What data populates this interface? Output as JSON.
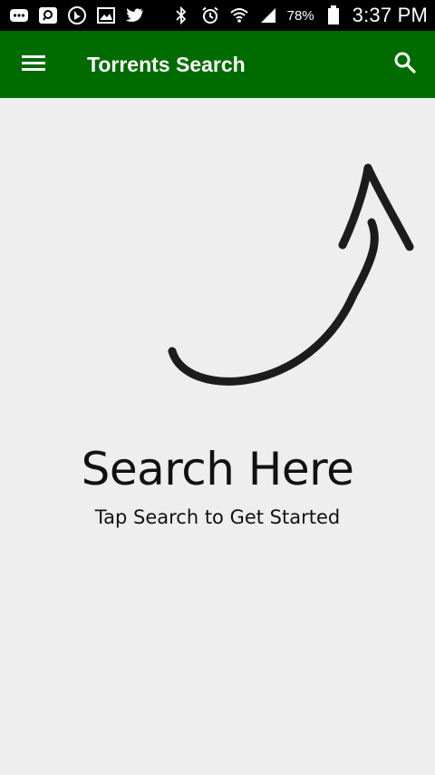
{
  "status_bar": {
    "battery_percent": "78%",
    "time": "3:37 PM",
    "left_icons": [
      "message-icon",
      "app-icon",
      "bing-icon",
      "gallery-icon",
      "twitter-icon"
    ],
    "right_icons": [
      "bluetooth-icon",
      "alarm-icon",
      "wifi-icon",
      "signal-icon",
      "battery-icon"
    ]
  },
  "app_bar": {
    "title": "Torrents Search",
    "background": "#006b00",
    "menu_icon": "hamburger-menu-icon",
    "search_icon": "search-icon"
  },
  "empty_state": {
    "title": "Search Here",
    "subtitle": "Tap Search to Get Started",
    "arrow_icon": "curved-arrow-icon"
  }
}
